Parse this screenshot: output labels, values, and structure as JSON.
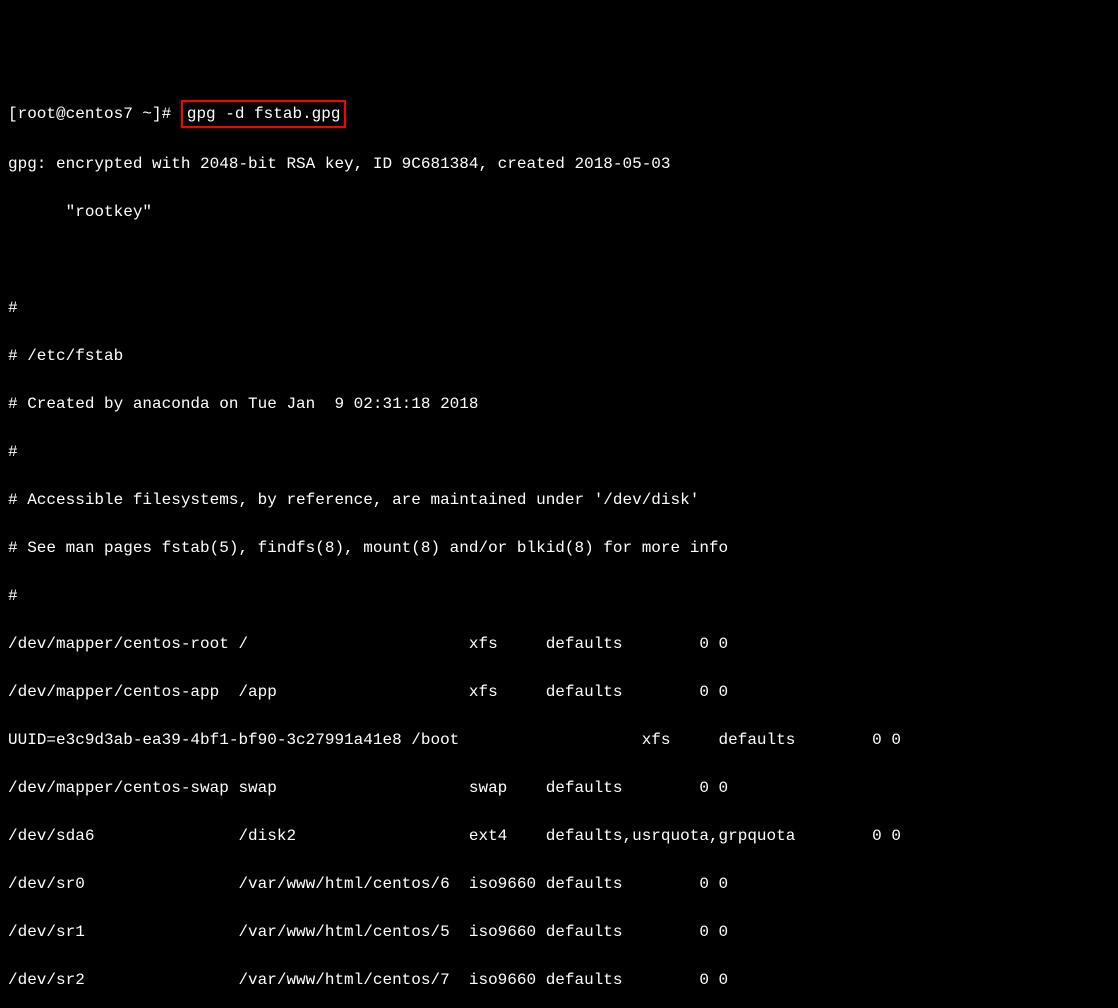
{
  "prompt": {
    "user_host": "[root@centos7 ~]#",
    "command": "gpg -d fstab.gpg"
  },
  "gpg_output": {
    "line1": "gpg: encrypted with 2048-bit RSA key, ID 9C681384, created 2018-05-03",
    "line2": "      \"rootkey\""
  },
  "fstab": {
    "header1": "#",
    "header2": "# /etc/fstab",
    "header3": "# Created by anaconda on Tue Jan  9 02:31:18 2018",
    "header4": "#",
    "header5": "# Accessible filesystems, by reference, are maintained under '/dev/disk'",
    "header6": "# See man pages fstab(5), findfs(8), mount(8) and/or blkid(8) for more info",
    "header7": "#",
    "entries": [
      "/dev/mapper/centos-root /                       xfs     defaults        0 0",
      "/dev/mapper/centos-app  /app                    xfs     defaults        0 0",
      "UUID=e3c9d3ab-ea39-4bf1-bf90-3c27991a41e8 /boot                   xfs     defaults        0 0",
      "/dev/mapper/centos-swap swap                    swap    defaults        0 0",
      "/dev/sda6               /disk2                  ext4    defaults,usrquota,grpquota        0 0",
      "/dev/sr0                /var/www/html/centos/6  iso9660 defaults        0 0",
      "/dev/sr1                /var/www/html/centos/5  iso9660 defaults        0 0",
      "/dev/sr2                /var/www/html/centos/7  iso9660 defaults        0 0"
    ]
  }
}
